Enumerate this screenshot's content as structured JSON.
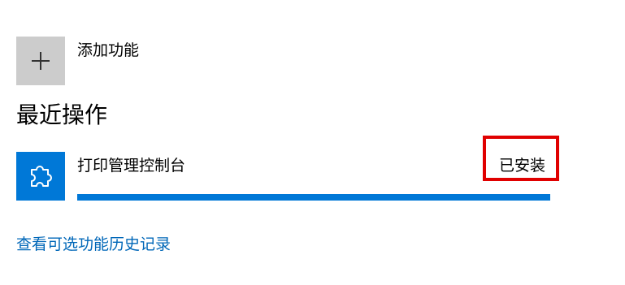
{
  "add_feature": {
    "icon": "plus-icon",
    "label": "添加功能"
  },
  "recent_actions": {
    "title": "最近操作",
    "items": [
      {
        "icon": "puzzle-piece-icon",
        "name": "打印管理控制台",
        "status": "已安装",
        "progress": 1.0
      }
    ]
  },
  "history_link": {
    "label": "查看可选功能历史记录"
  },
  "colors": {
    "accent": "#0078d7",
    "link": "#0067b8",
    "highlight": "#e00000",
    "tile_gray": "#cccccc"
  }
}
